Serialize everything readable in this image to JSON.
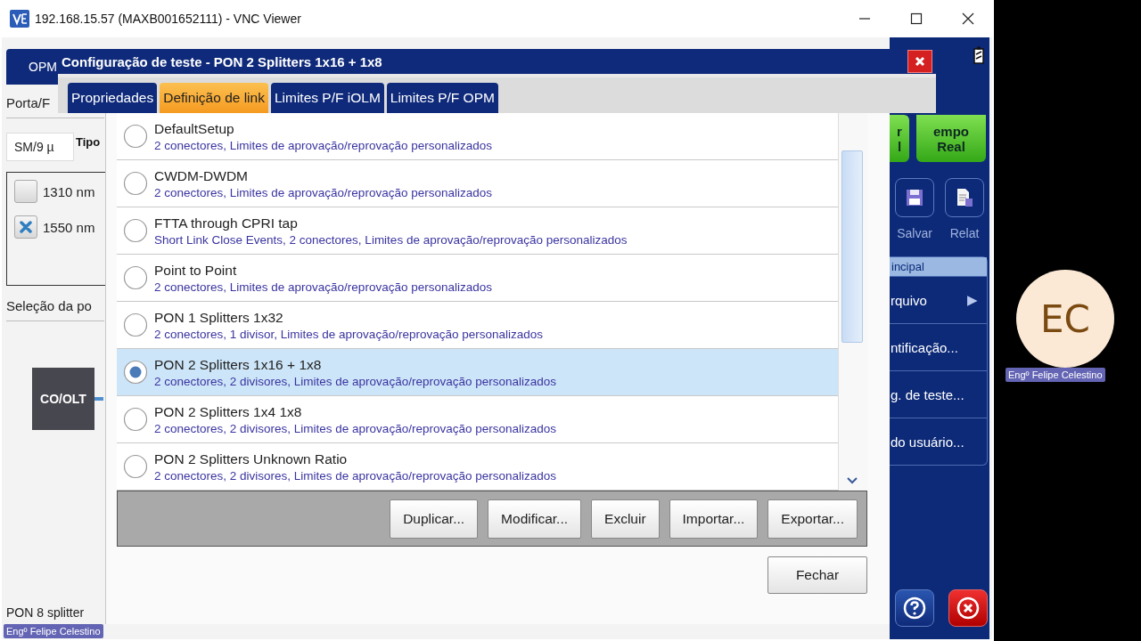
{
  "vnc_window": {
    "title": "192.168.15.57 (MAXB001652111) - VNC Viewer"
  },
  "background_app": {
    "tab": "OPM",
    "port_label": "Porta/F",
    "fiber_field": "SM/9 µ",
    "type_label": "Tipo",
    "wavelengths": [
      {
        "label": "1310 nm",
        "checked": false
      },
      {
        "label": "1550 nm",
        "checked": true
      }
    ],
    "section_label": "Seleção da po",
    "node_label": "CO/OLT",
    "footer_label": "PON 8 splitter"
  },
  "side_panel": {
    "action_buttons": [
      {
        "lines": [
          "r",
          "l"
        ]
      },
      {
        "lines": [
          "empo",
          "Real"
        ]
      }
    ],
    "tool_buttons": [
      {
        "kind": "save",
        "label": "Salvar"
      },
      {
        "kind": "report",
        "label": "Relat"
      }
    ],
    "menu": {
      "header": "incipal",
      "items": [
        {
          "label": "rquivo",
          "arrow": "▶"
        },
        {
          "label": "ntificação..."
        },
        {
          "label": "g. de teste..."
        },
        {
          "label": "do usuário..."
        }
      ]
    }
  },
  "dialog": {
    "title": "Configuração de teste - PON 2 Splitters 1x16 + 1x8",
    "tabs": [
      {
        "label": "Propriedades",
        "selected": false
      },
      {
        "label": "Definição de link",
        "selected": true
      },
      {
        "label": "Limites P/F iOLM",
        "selected": false
      },
      {
        "label": "Limites P/F OPM",
        "selected": false
      }
    ],
    "setups": [
      {
        "name": "DefaultSetup",
        "description": "2 conectores, Limites de aprovação/reprovação personalizados",
        "selected": false
      },
      {
        "name": "CWDM-DWDM",
        "description": "2 conectores, Limites de aprovação/reprovação personalizados",
        "selected": false
      },
      {
        "name": "FTTA through CPRI tap",
        "description": "Short Link Close Events, 2 conectores, Limites de aprovação/reprovação personalizados",
        "selected": false
      },
      {
        "name": "Point to Point",
        "description": "2 conectores, Limites de aprovação/reprovação personalizados",
        "selected": false
      },
      {
        "name": "PON 1 Splitters 1x32",
        "description": "2 conectores, 1 divisor, Limites de aprovação/reprovação personalizados",
        "selected": false
      },
      {
        "name": "PON 2 Splitters 1x16 + 1x8",
        "description": "2 conectores, 2 divisores, Limites de aprovação/reprovação personalizados",
        "selected": true
      },
      {
        "name": "PON 2 Splitters 1x4 1x8",
        "description": "2 conectores, 2 divisores, Limites de aprovação/reprovação personalizados",
        "selected": false
      },
      {
        "name": "PON 2 Splitters Unknown Ratio",
        "description": "2 conectores, 2 divisores, Limites de aprovação/reprovação personalizados",
        "selected": false
      }
    ],
    "actions": [
      "Duplicar...",
      "Modificar...",
      "Excluir",
      "Importar...",
      "Exportar..."
    ],
    "close_button": "Fechar"
  },
  "call_overlay": {
    "initials": "EC",
    "name_tags": [
      "Engº  Felipe Celestino",
      "Engº  Felipe Celestino"
    ]
  }
}
